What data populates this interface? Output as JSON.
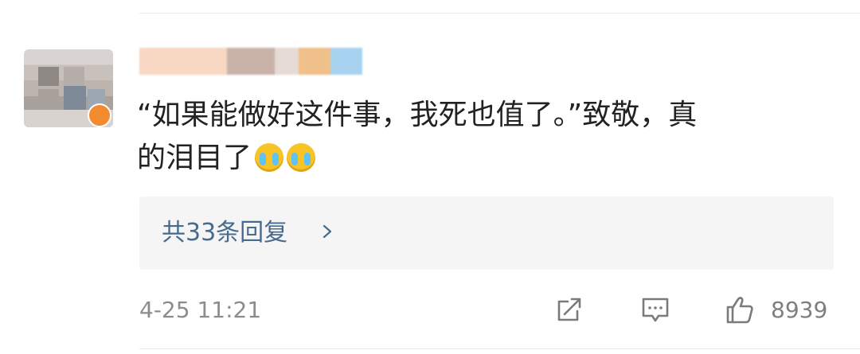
{
  "comment": {
    "line1": "“如果能做好这件事，我死也值了。”致敬，真",
    "line2": "的泪目了",
    "emojis": [
      "crying-face",
      "crying-face"
    ]
  },
  "replies": {
    "label": "共33条回复"
  },
  "footer": {
    "timestamp": "4-25 11:21",
    "like_count": "8939"
  },
  "colors": {
    "link": "#476a8f",
    "meta": "#8c8c8c",
    "reply_bg": "#f5f5f5"
  }
}
